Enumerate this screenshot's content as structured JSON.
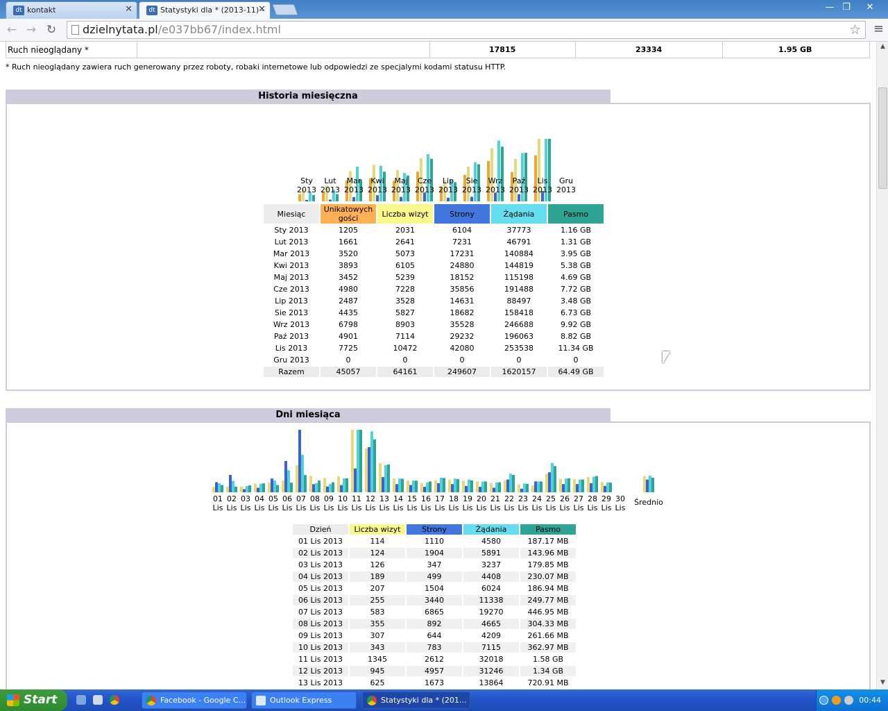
{
  "browser": {
    "tabs": [
      {
        "label": "kontakt",
        "favicon": "dt"
      },
      {
        "label": "Statystyki dla * (2013-11) - ",
        "favicon": "dt"
      }
    ],
    "url_host": "dzielnytata.pl",
    "url_path": "/e037bb67/index.html",
    "icons": {
      "back": "←",
      "forward": "→",
      "reload": "↻",
      "star": "☆",
      "menu": "≡",
      "close": "✕",
      "minimize": "—",
      "restore": "❐"
    }
  },
  "top_row": {
    "label": "Ruch nieoglądany *",
    "v1": "17815",
    "v2": "23334",
    "v3": "1.95 GB"
  },
  "note": "* Ruch nieoglądany zawiera ruch generowany przez roboty, robaki internetowe lub odpowiedzi ze specjalymi kodami statusu HTTP.",
  "monthly": {
    "title": "Historia miesięczna",
    "headers": [
      "Miesiąc",
      "Unikatowych gości",
      "Liczba wizyt",
      "Strony",
      "Żądania",
      "Pasmo"
    ],
    "rows": [
      [
        "Sty 2013",
        "1205",
        "2031",
        "6104",
        "37773",
        "1.16 GB"
      ],
      [
        "Lut 2013",
        "1661",
        "2641",
        "7231",
        "46791",
        "1.31 GB"
      ],
      [
        "Mar 2013",
        "3520",
        "5073",
        "17231",
        "140884",
        "3.95 GB"
      ],
      [
        "Kwi 2013",
        "3893",
        "6105",
        "24880",
        "144819",
        "5.38 GB"
      ],
      [
        "Maj 2013",
        "3452",
        "5239",
        "18152",
        "115198",
        "4.69 GB"
      ],
      [
        "Cze 2013",
        "4980",
        "7228",
        "35856",
        "191488",
        "7.72 GB"
      ],
      [
        "Lip 2013",
        "2487",
        "3528",
        "14631",
        "88497",
        "3.48 GB"
      ],
      [
        "Sie 2013",
        "4435",
        "5827",
        "18682",
        "158418",
        "6.73 GB"
      ],
      [
        "Wrz 2013",
        "6798",
        "8903",
        "35528",
        "246688",
        "9.92 GB"
      ],
      [
        "Paź 2013",
        "4901",
        "7114",
        "29232",
        "196063",
        "8.82 GB"
      ],
      [
        "Lis 2013",
        "7725",
        "10472",
        "42080",
        "253538",
        "11.34 GB"
      ],
      [
        "Gru 2013",
        "0",
        "0",
        "0",
        "0",
        "0"
      ]
    ],
    "total": [
      "Razem",
      "45057",
      "64161",
      "249607",
      "1620157",
      "64.49 GB"
    ],
    "chart_labels": [
      [
        "Sty",
        "2013"
      ],
      [
        "Lut",
        "2013"
      ],
      [
        "Mar",
        "2013"
      ],
      [
        "Kwi",
        "2013"
      ],
      [
        "Maj",
        "2013"
      ],
      [
        "Cze",
        "2013"
      ],
      [
        "Lip",
        "2013"
      ],
      [
        "Sie",
        "2013"
      ],
      [
        "Wrz",
        "2013"
      ],
      [
        "Paź",
        "2013"
      ],
      [
        "Lis",
        "2013"
      ],
      [
        "Gru",
        "2013"
      ]
    ]
  },
  "daily": {
    "title": "Dni miesiąca",
    "headers": [
      "Dzień",
      "Liczba wizyt",
      "Strony",
      "Żądania",
      "Pasmo"
    ],
    "rows": [
      [
        "01 Lis 2013",
        "114",
        "1110",
        "4580",
        "187.17 MB"
      ],
      [
        "02 Lis 2013",
        "124",
        "1904",
        "5891",
        "143.96 MB"
      ],
      [
        "03 Lis 2013",
        "126",
        "347",
        "3237",
        "179.85 MB"
      ],
      [
        "04 Lis 2013",
        "189",
        "499",
        "4408",
        "230.07 MB"
      ],
      [
        "05 Lis 2013",
        "207",
        "1504",
        "6024",
        "186.94 MB"
      ],
      [
        "06 Lis 2013",
        "255",
        "3440",
        "11338",
        "249.77 MB"
      ],
      [
        "07 Lis 2013",
        "583",
        "6865",
        "19270",
        "446.95 MB"
      ],
      [
        "08 Lis 2013",
        "355",
        "892",
        "4665",
        "304.33 MB"
      ],
      [
        "09 Lis 2013",
        "307",
        "644",
        "4209",
        "261.66 MB"
      ],
      [
        "10 Lis 2013",
        "343",
        "783",
        "7115",
        "362.97 MB"
      ],
      [
        "11 Lis 2013",
        "1345",
        "2612",
        "32018",
        "1.58 GB"
      ],
      [
        "12 Lis 2013",
        "945",
        "4957",
        "31246",
        "1.34 GB"
      ],
      [
        "13 Lis 2013",
        "625",
        "1673",
        "13864",
        "720.91 MB"
      ]
    ],
    "day_labels": [
      "01",
      "02",
      "03",
      "04",
      "05",
      "06",
      "07",
      "08",
      "09",
      "10",
      "11",
      "12",
      "13",
      "14",
      "15",
      "16",
      "17",
      "18",
      "19",
      "20",
      "21",
      "22",
      "23",
      "24",
      "25",
      "26",
      "27",
      "28",
      "29",
      "30"
    ],
    "month_short": "Lis",
    "avg_label": "Średnio"
  },
  "chart_data": [
    {
      "type": "bar",
      "title": "Historia miesięczna",
      "categories": [
        "Sty 2013",
        "Lut 2013",
        "Mar 2013",
        "Kwi 2013",
        "Maj 2013",
        "Cze 2013",
        "Lip 2013",
        "Sie 2013",
        "Wrz 2013",
        "Paź 2013",
        "Lis 2013",
        "Gru 2013"
      ],
      "series": [
        {
          "name": "Unikatowych gości",
          "values": [
            1205,
            1661,
            3520,
            3893,
            3452,
            4980,
            2487,
            4435,
            6798,
            4901,
            7725,
            0
          ]
        },
        {
          "name": "Liczba wizyt",
          "values": [
            2031,
            2641,
            5073,
            6105,
            5239,
            7228,
            3528,
            5827,
            8903,
            7114,
            10472,
            0
          ]
        },
        {
          "name": "Strony",
          "values": [
            6104,
            7231,
            17231,
            24880,
            18152,
            35856,
            14631,
            18682,
            35528,
            29232,
            42080,
            0
          ]
        },
        {
          "name": "Żądania",
          "values": [
            37773,
            46791,
            140884,
            144819,
            115198,
            191488,
            88497,
            158418,
            246688,
            196063,
            253538,
            0
          ]
        },
        {
          "name": "Pasmo",
          "values": [
            1.16,
            1.31,
            3.95,
            5.38,
            4.69,
            7.72,
            3.48,
            6.73,
            9.92,
            8.82,
            11.34,
            0
          ]
        }
      ]
    },
    {
      "type": "bar",
      "title": "Dni miesiąca",
      "categories": [
        "01",
        "02",
        "03",
        "04",
        "05",
        "06",
        "07",
        "08",
        "09",
        "10",
        "11",
        "12",
        "13",
        "14",
        "15",
        "16",
        "17",
        "18",
        "19",
        "20",
        "21",
        "22",
        "23",
        "24",
        "25",
        "26",
        "27",
        "28",
        "29",
        "30",
        "Średnio"
      ],
      "series": [
        {
          "name": "Liczba wizyt",
          "values": [
            114,
            124,
            126,
            189,
            207,
            255,
            583,
            355,
            307,
            343,
            1345,
            945,
            625,
            300,
            250,
            200,
            260,
            270,
            250,
            230,
            200,
            260,
            170,
            150,
            400,
            290,
            280,
            330,
            220,
            0,
            349
          ]
        },
        {
          "name": "Strony",
          "values": [
            1110,
            1904,
            347,
            499,
            1504,
            3440,
            6865,
            892,
            644,
            783,
            2612,
            4957,
            1673,
            900,
            800,
            600,
            1000,
            900,
            700,
            600,
            500,
            1400,
            400,
            1200,
            2200,
            900,
            900,
            1000,
            700,
            0,
            1403
          ]
        },
        {
          "name": "Żądania",
          "values": [
            4580,
            5891,
            3237,
            4408,
            6024,
            11338,
            19270,
            4665,
            4209,
            7115,
            32018,
            31246,
            13864,
            7000,
            6000,
            5000,
            7500,
            7000,
            6500,
            5500,
            5000,
            9500,
            4500,
            5500,
            15000,
            7000,
            6500,
            8000,
            5000,
            0,
            8500
          ]
        },
        {
          "name": "Pasmo",
          "values": [
            187,
            144,
            180,
            230,
            187,
            250,
            447,
            304,
            262,
            363,
            1620,
            1372,
            721,
            350,
            300,
            280,
            370,
            340,
            310,
            280,
            260,
            450,
            220,
            280,
            680,
            360,
            330,
            420,
            250,
            0,
            378
          ]
        }
      ]
    }
  ],
  "taskbar": {
    "start": "Start",
    "tasks": [
      "Facebook - Google C...",
      "Outlook Express",
      "Statystyki dla * (201..."
    ],
    "clock": "00:44"
  }
}
